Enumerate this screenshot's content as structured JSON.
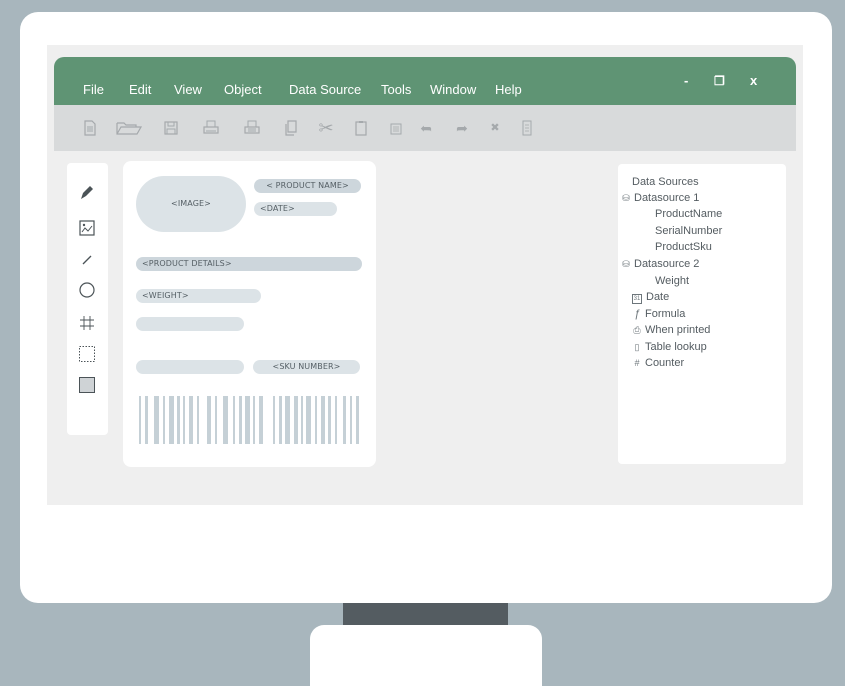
{
  "menu": {
    "items": [
      "File",
      "Edit",
      "View",
      "Object",
      "Data Source",
      "Tools",
      "Window",
      "Help"
    ]
  },
  "window_controls": {
    "minimize": "-",
    "maximize": "❐",
    "close": "x"
  },
  "toolbar": {
    "icons": [
      "new-document-icon",
      "open-folder-icon",
      "save-icon",
      "print-icon",
      "print-preview-icon",
      "copy-icon",
      "cut-icon",
      "paste-icon",
      "paste-special-icon",
      "undo-icon",
      "redo-icon",
      "delete-icon",
      "properties-icon"
    ],
    "undo_glyph": "➥",
    "redo_glyph": "➦",
    "delete_glyph": "✖",
    "cut_glyph": "✂"
  },
  "tools": [
    "pen-icon",
    "image-icon",
    "line-icon",
    "circle-icon",
    "grid-icon",
    "dotted-rectangle-icon",
    "filled-rectangle-icon"
  ],
  "label": {
    "image": "<IMAGE>",
    "product_name": "< PRODUCT NAME>",
    "date": "<DATE>",
    "product_details": "<PRODUCT DETAILS>",
    "weight": "<WEIGHT>",
    "sku_number": "<SKU NUMBER>"
  },
  "data_sources": {
    "title": "Data Sources",
    "items": [
      {
        "label": "Datasource 1",
        "icon": "database-icon",
        "glyph": "⛁",
        "indent": 0
      },
      {
        "label": "ProductName",
        "indent": 1
      },
      {
        "label": "SerialNumber",
        "indent": 1
      },
      {
        "label": "ProductSku",
        "indent": 1
      },
      {
        "label": "Datasource 2",
        "icon": "database-icon",
        "glyph": "⛁",
        "indent": 0
      },
      {
        "label": "Weight",
        "indent": 1
      },
      {
        "label": "Date",
        "icon": "calendar-icon",
        "glyph": "31",
        "indent": 0
      },
      {
        "label": "Formula",
        "icon": "formula-icon",
        "glyph": "ƒ",
        "indent": 0
      },
      {
        "label": "When printed",
        "icon": "printer-icon",
        "glyph": "⎙",
        "indent": 0
      },
      {
        "label": "Table lookup",
        "icon": "table-icon",
        "glyph": "▯",
        "indent": 0
      },
      {
        "label": "Counter",
        "icon": "counter-icon",
        "glyph": "#",
        "indent": 0
      }
    ]
  },
  "colors": {
    "background": "#a8b6bd",
    "titlebar": "#5f9474",
    "toolbar": "#d8dadb",
    "placeholder": "#dce3e7",
    "barcode": "#c5d0d6"
  }
}
